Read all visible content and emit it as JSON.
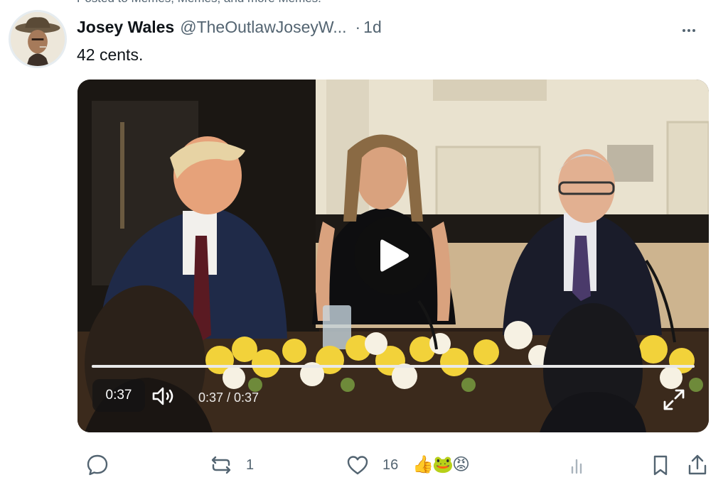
{
  "context": {
    "text": "Posted to Memes, Memes, and more Memes."
  },
  "post": {
    "author_name": "Josey Wales",
    "author_handle": "@TheOutlawJoseyW...",
    "separator": "·",
    "time": "1d",
    "text": "42 cents."
  },
  "video": {
    "badge_time": "0:37",
    "readout": "0:37 / 0:37",
    "progress_fraction": 1.0
  },
  "actions": {
    "reply_icon": "speech-bubble-icon",
    "repost_icon": "repost-icon",
    "repost_count": "1",
    "like_icon": "heart-icon",
    "like_count": "16",
    "reactions": [
      "👍",
      "🐸",
      "😡"
    ],
    "views_icon": "bar-chart-icon",
    "bookmark_icon": "bookmark-icon",
    "share_icon": "share-icon"
  },
  "colors": {
    "text_primary": "#0f1419",
    "text_secondary": "#536471",
    "background": "#ffffff"
  }
}
